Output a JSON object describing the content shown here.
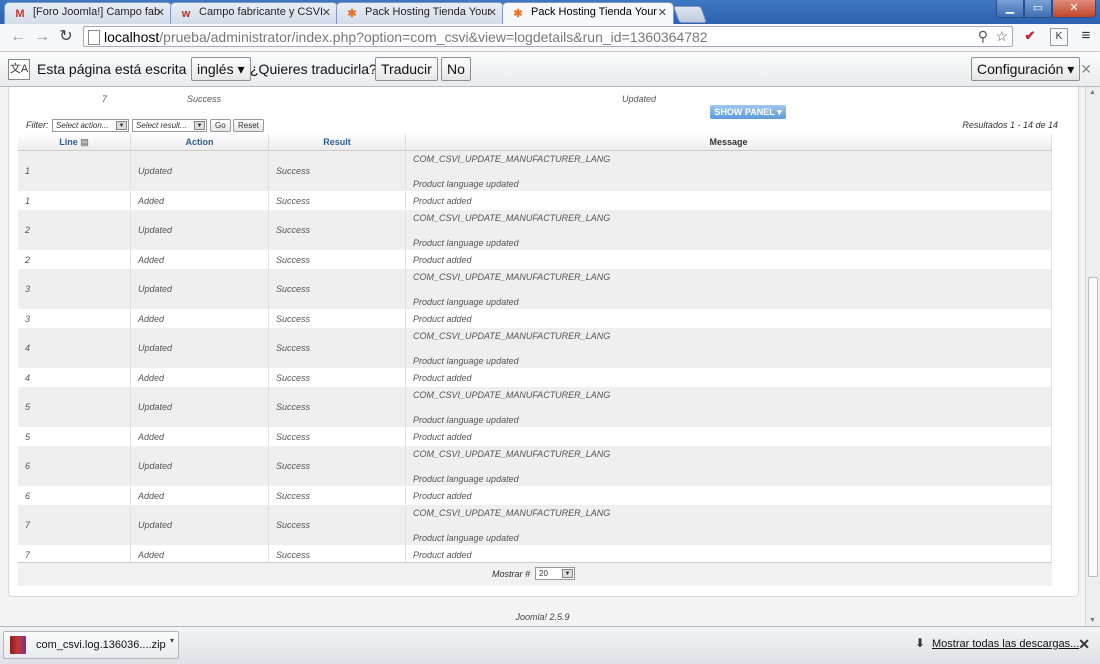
{
  "browser": {
    "tabs": [
      {
        "title": "[Foro Joomla!] Campo fab",
        "icon": "gmail-icon"
      },
      {
        "title": "Campo fabricante y CSVI",
        "icon": "wordpress-icon"
      },
      {
        "title": "Pack Hosting Tienda Your",
        "icon": "joomla-icon"
      },
      {
        "title": "Pack Hosting Tienda Your",
        "icon": "joomla-icon"
      }
    ],
    "url_host": "localhost",
    "url_path": "/prueba/administrator/index.php?option=com_csvi&view=logdetails&run_id=1360364782",
    "extensions": [
      "K"
    ]
  },
  "translate_bar": {
    "prefix": "Esta página está escrita en",
    "language": "inglés",
    "question": "¿Quieres traducirla?",
    "translate_button": "Traducir",
    "no_button": "No",
    "config_button": "Configuración"
  },
  "summary": {
    "line": "7",
    "result": "Success",
    "action": "Updated",
    "show_panel": "SHOW PANEL"
  },
  "filter": {
    "label": "Filter:",
    "action_select": "Select action...",
    "result_select": "Select result...",
    "go": "Go",
    "reset": "Reset",
    "results": "Resultados 1 - 14 de 14"
  },
  "table": {
    "headers": {
      "line": "Line",
      "action": "Action",
      "result": "Result",
      "message": "Message"
    },
    "rows": [
      {
        "line": "1",
        "action": "Updated",
        "result": "Success",
        "msg1": "COM_CSVI_UPDATE_MANUFACTURER_LANG",
        "msg2": "Product language updated"
      },
      {
        "line": "1",
        "action": "Added",
        "result": "Success",
        "msg1": "Product added"
      },
      {
        "line": "2",
        "action": "Updated",
        "result": "Success",
        "msg1": "COM_CSVI_UPDATE_MANUFACTURER_LANG",
        "msg2": "Product language updated"
      },
      {
        "line": "2",
        "action": "Added",
        "result": "Success",
        "msg1": "Product added"
      },
      {
        "line": "3",
        "action": "Updated",
        "result": "Success",
        "msg1": "COM_CSVI_UPDATE_MANUFACTURER_LANG",
        "msg2": "Product language updated"
      },
      {
        "line": "3",
        "action": "Added",
        "result": "Success",
        "msg1": "Product added"
      },
      {
        "line": "4",
        "action": "Updated",
        "result": "Success",
        "msg1": "COM_CSVI_UPDATE_MANUFACTURER_LANG",
        "msg2": "Product language updated"
      },
      {
        "line": "4",
        "action": "Added",
        "result": "Success",
        "msg1": "Product added"
      },
      {
        "line": "5",
        "action": "Updated",
        "result": "Success",
        "msg1": "COM_CSVI_UPDATE_MANUFACTURER_LANG",
        "msg2": "Product language updated"
      },
      {
        "line": "5",
        "action": "Added",
        "result": "Success",
        "msg1": "Product added"
      },
      {
        "line": "6",
        "action": "Updated",
        "result": "Success",
        "msg1": "COM_CSVI_UPDATE_MANUFACTURER_LANG",
        "msg2": "Product language updated"
      },
      {
        "line": "6",
        "action": "Added",
        "result": "Success",
        "msg1": "Product added"
      },
      {
        "line": "7",
        "action": "Updated",
        "result": "Success",
        "msg1": "COM_CSVI_UPDATE_MANUFACTURER_LANG",
        "msg2": "Product language updated"
      },
      {
        "line": "7",
        "action": "Added",
        "result": "Success",
        "msg1": "Product added"
      }
    ]
  },
  "pagination": {
    "label": "Mostrar #",
    "value": "20"
  },
  "footer": {
    "version": "Joomla! 2.5.9"
  },
  "downloads": {
    "file": "com_csvi.log.136036....zip",
    "show_all": "Mostrar todas las descargas..."
  }
}
